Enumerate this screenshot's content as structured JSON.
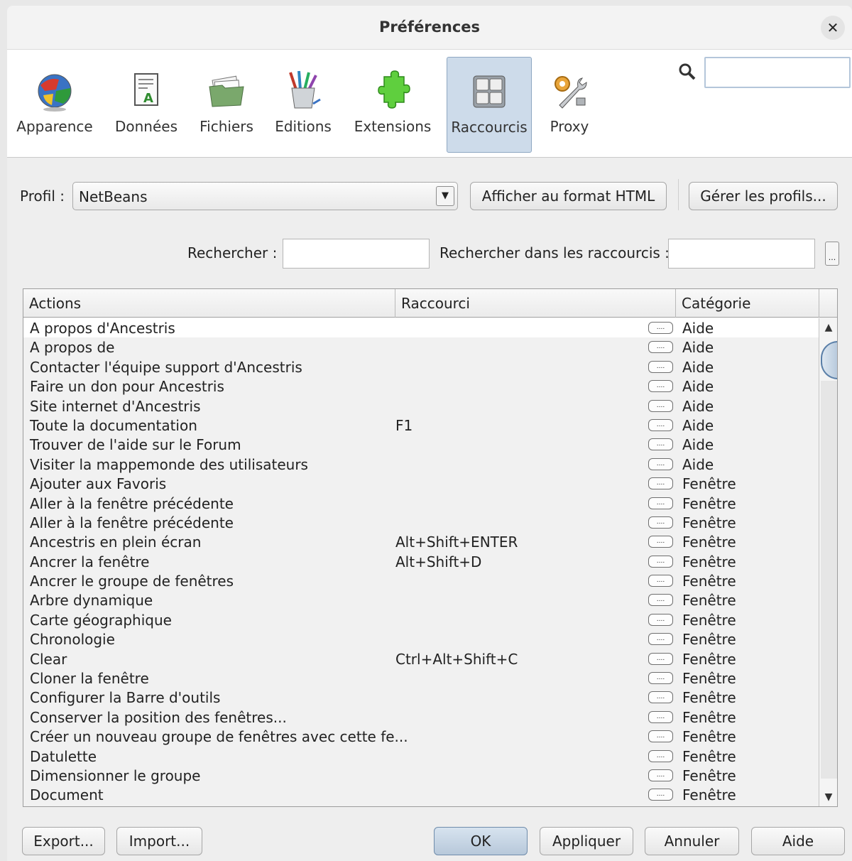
{
  "window": {
    "title": "Préférences"
  },
  "categories": [
    {
      "label": "Apparence",
      "icon": "globe-icon",
      "active": false
    },
    {
      "label": "Données",
      "icon": "data-document-icon",
      "active": false
    },
    {
      "label": "Fichiers",
      "icon": "folder-files-icon",
      "active": false
    },
    {
      "label": "Editions",
      "icon": "pencil-cup-icon",
      "active": false
    },
    {
      "label": "Extensions",
      "icon": "puzzle-piece-icon",
      "active": false
    },
    {
      "label": "Raccourcis",
      "icon": "keyboard-icon",
      "active": true
    },
    {
      "label": "Proxy",
      "icon": "gear-wrench-icon",
      "active": false
    }
  ],
  "profile": {
    "label": "Profil :",
    "value": "NetBeans",
    "html_button": "Afficher au format HTML",
    "manage_button": "Gérer les profils..."
  },
  "search": {
    "label": "Rechercher :",
    "shortcut_label": "Rechercher dans les raccourcis :",
    "kbd_button": "..."
  },
  "table": {
    "columns": [
      "Actions",
      "Raccourci",
      "Catégorie"
    ],
    "kbd_label": "....",
    "rows": [
      {
        "action": "A propos d'Ancestris",
        "shortcut": "",
        "category": "Aide"
      },
      {
        "action": "A propos de",
        "shortcut": "",
        "category": "Aide"
      },
      {
        "action": "Contacter l'équipe support d'Ancestris",
        "shortcut": "",
        "category": "Aide"
      },
      {
        "action": "Faire un don pour Ancestris",
        "shortcut": "",
        "category": "Aide"
      },
      {
        "action": "Site internet d'Ancestris",
        "shortcut": "",
        "category": "Aide"
      },
      {
        "action": "Toute la documentation",
        "shortcut": "F1",
        "category": "Aide"
      },
      {
        "action": "Trouver de l'aide sur le Forum",
        "shortcut": "",
        "category": "Aide"
      },
      {
        "action": "Visiter la mappemonde des utilisateurs",
        "shortcut": "",
        "category": "Aide"
      },
      {
        "action": "Ajouter aux Favoris",
        "shortcut": "",
        "category": "Fenêtre"
      },
      {
        "action": "Aller à la fenêtre précédente",
        "shortcut": "",
        "category": "Fenêtre"
      },
      {
        "action": "Aller à la fenêtre précédente",
        "shortcut": "",
        "category": "Fenêtre"
      },
      {
        "action": "Ancestris en plein écran",
        "shortcut": "Alt+Shift+ENTER",
        "category": "Fenêtre"
      },
      {
        "action": "Ancrer la fenêtre",
        "shortcut": "Alt+Shift+D",
        "category": "Fenêtre"
      },
      {
        "action": "Ancrer le groupe de fenêtres",
        "shortcut": "",
        "category": "Fenêtre"
      },
      {
        "action": "Arbre dynamique",
        "shortcut": "",
        "category": "Fenêtre"
      },
      {
        "action": "Carte géographique",
        "shortcut": "",
        "category": "Fenêtre"
      },
      {
        "action": "Chronologie",
        "shortcut": "",
        "category": "Fenêtre"
      },
      {
        "action": "Clear",
        "shortcut": "Ctrl+Alt+Shift+C",
        "category": "Fenêtre"
      },
      {
        "action": "Cloner la fenêtre",
        "shortcut": "",
        "category": "Fenêtre"
      },
      {
        "action": "Configurer la Barre d'outils",
        "shortcut": "",
        "category": "Fenêtre"
      },
      {
        "action": "Conserver la position des fenêtres...",
        "shortcut": "",
        "category": "Fenêtre"
      },
      {
        "action": "Créer un nouveau groupe de fenêtres avec cette fe...",
        "shortcut": "",
        "category": "Fenêtre"
      },
      {
        "action": "Datulette",
        "shortcut": "",
        "category": "Fenêtre"
      },
      {
        "action": "Dimensionner le groupe",
        "shortcut": "",
        "category": "Fenêtre"
      },
      {
        "action": "Document",
        "shortcut": "",
        "category": "Fenêtre"
      }
    ]
  },
  "footer": {
    "export": "Export...",
    "import": "Import...",
    "ok": "OK",
    "apply": "Appliquer",
    "cancel": "Annuler",
    "help": "Aide"
  },
  "colors": {
    "active_tab": "#cddbea",
    "ok_button": "#b7c8da",
    "scroll_thumb": "#5a7fa8"
  }
}
